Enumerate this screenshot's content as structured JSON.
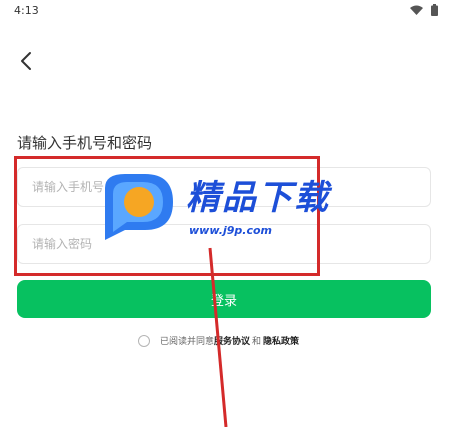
{
  "status_bar": {
    "time": "4:13",
    "icons": [
      "wifi-icon",
      "battery-icon"
    ]
  },
  "nav": {
    "back_icon": "chevron-left-icon"
  },
  "form": {
    "title": "请输入手机号和密码",
    "phone_placeholder": "请输入手机号",
    "password_placeholder": "请输入密码",
    "login_label": "登录"
  },
  "agreement": {
    "prefix": "已阅读并同意",
    "service_link": "服务协议",
    "connector": "和",
    "privacy_link": "隐私政策"
  },
  "watermark": {
    "brand": "精品下载",
    "url": "www.j9p.com"
  },
  "colors": {
    "primary": "#07c160",
    "annotation": "#d42a2a",
    "watermark": "#1d4fd8"
  }
}
